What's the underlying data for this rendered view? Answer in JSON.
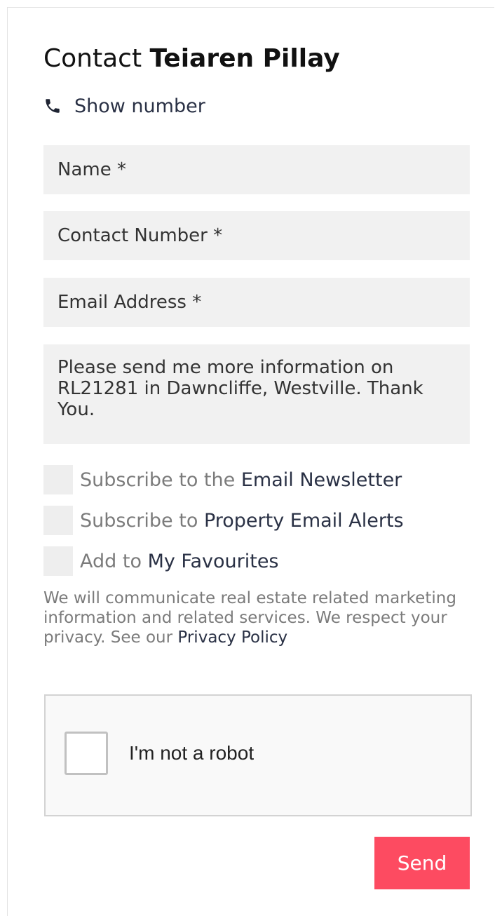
{
  "contact": {
    "title_prefix": "Contact",
    "agent_name": "Teiaren Pillay",
    "show_number_label": "Show number"
  },
  "form": {
    "name_placeholder": "Name *",
    "contact_number_placeholder": "Contact Number *",
    "email_placeholder": "Email Address *",
    "message_value": "Please send me more information on RL21281 in Dawncliffe, Westville. Thank You."
  },
  "options": {
    "newsletter_prefix": "Subscribe to the",
    "newsletter_link": "Email Newsletter",
    "alerts_prefix": "Subscribe to",
    "alerts_link": "Property Email Alerts",
    "favourites_prefix": "Add to",
    "favourites_link": "My Favourites"
  },
  "privacy": {
    "text": "We will communicate real estate related marketing information and related services. We respect your privacy. See our",
    "link": "Privacy Policy"
  },
  "captcha": {
    "label": "I'm not a robot"
  },
  "actions": {
    "send_label": "Send"
  },
  "colors": {
    "accent": "#fd4b61",
    "link": "#2a3145",
    "field_bg": "#f1f1f1",
    "muted_text": "#7b7b7b"
  }
}
